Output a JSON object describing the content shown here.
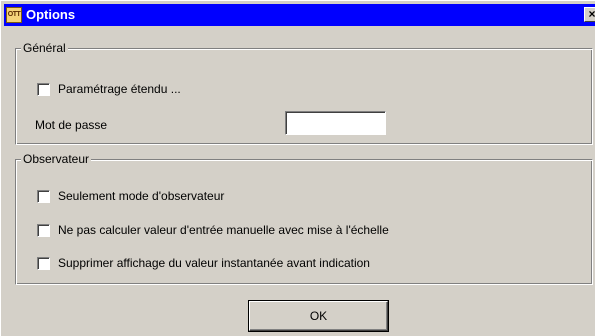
{
  "window": {
    "title": "Options",
    "icon_text": "OTT",
    "close_glyph": "×"
  },
  "general": {
    "legend": "Général",
    "extended_settings": {
      "label": "Paramétrage étendu ...",
      "checked": false
    },
    "password": {
      "label": "Mot de passe",
      "value": ""
    }
  },
  "observer": {
    "legend": "Observateur",
    "options": [
      {
        "label": "Seulement mode d'observateur",
        "checked": false
      },
      {
        "label": "Ne pas calculer valeur d'entrée manuelle avec mise à l'échelle",
        "checked": false
      },
      {
        "label": "Supprimer affichage du valeur instantanée avant indication",
        "checked": false
      }
    ]
  },
  "buttons": {
    "ok_label": "OK"
  }
}
